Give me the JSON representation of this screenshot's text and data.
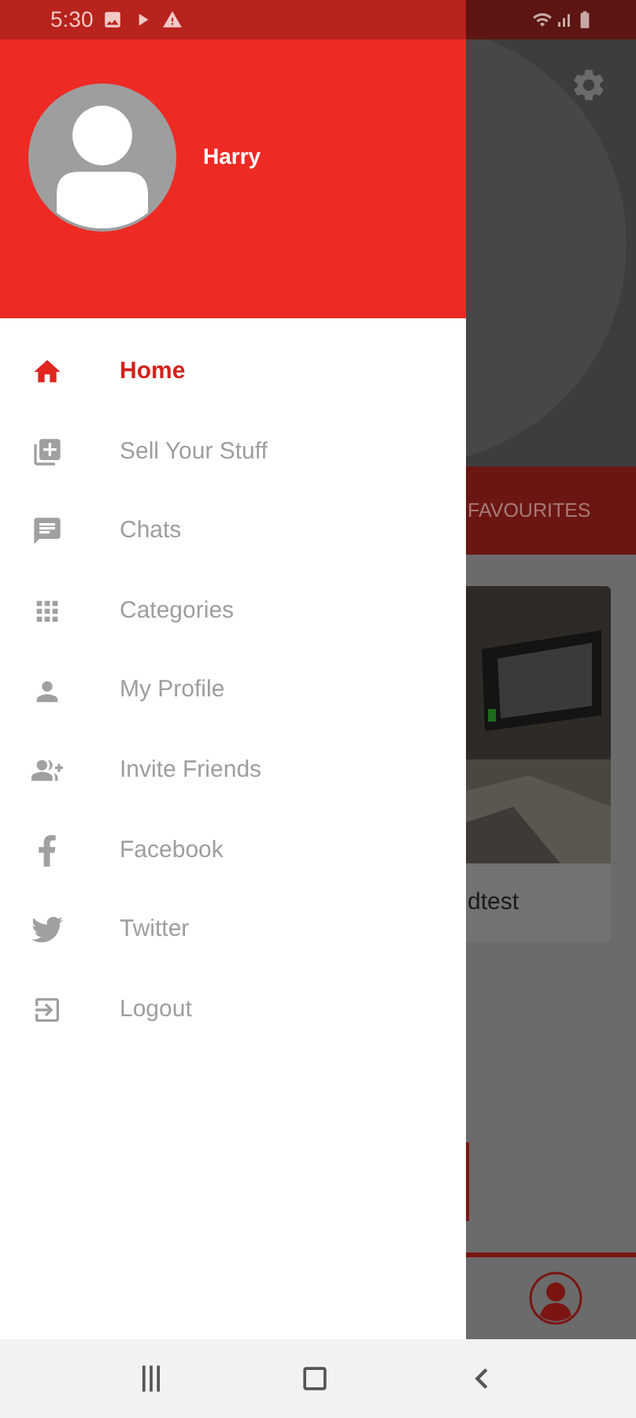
{
  "status_bar": {
    "time": "5:30"
  },
  "drawer": {
    "user_name": "Harry",
    "items": [
      {
        "label": "Home",
        "selected": true
      },
      {
        "label": "Sell Your Stuff",
        "selected": false
      },
      {
        "label": "Chats",
        "selected": false
      },
      {
        "label": "Categories",
        "selected": false
      },
      {
        "label": "My Profile",
        "selected": false
      },
      {
        "label": "Invite Friends",
        "selected": false
      },
      {
        "label": "Facebook",
        "selected": false
      },
      {
        "label": "Twitter",
        "selected": false
      },
      {
        "label": "Logout",
        "selected": false
      }
    ]
  },
  "background": {
    "tab": "FAVOURITES",
    "card_title": "dtest"
  }
}
